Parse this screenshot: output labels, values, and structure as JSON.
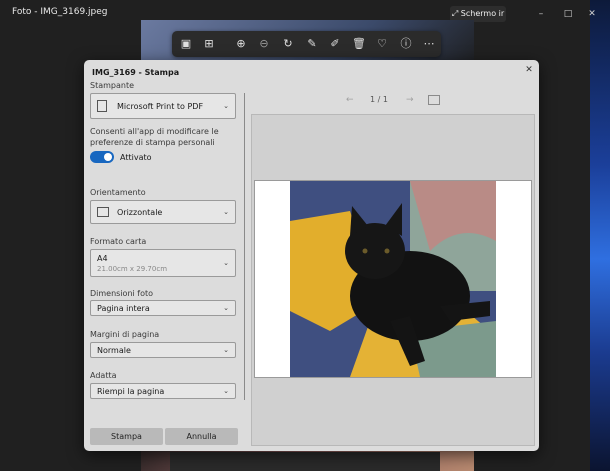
{
  "app": {
    "title": "Foto - IMG_3169.jpeg",
    "screen_button_label": "Schermo ir"
  },
  "window_controls": {
    "minimize": "–",
    "maximize": "□",
    "close": "✕"
  },
  "dialog": {
    "title": "IMG_3169 - Stampa",
    "printer": {
      "label": "Stampante",
      "value": "Microsoft Print to PDF"
    },
    "permission": {
      "text": "Consenti all'app di modificare le preferenze di stampa personali",
      "state": "Attivato"
    },
    "orientation": {
      "label": "Orientamento",
      "value": "Orizzontale"
    },
    "paper": {
      "label": "Formato carta",
      "value": "A4",
      "sub": "21.00cm x 29.70cm"
    },
    "photo_size": {
      "label": "Dimensioni foto",
      "value": "Pagina intera"
    },
    "margins": {
      "label": "Margini di pagina",
      "value": "Normale"
    },
    "fit": {
      "label": "Adatta",
      "value": "Riempi la pagina"
    },
    "print_button": "Stampa",
    "cancel_button": "Annulla",
    "pager": {
      "text": "1 / 1"
    }
  },
  "icons": {
    "toolbar": [
      "image-icon",
      "crop-icon",
      "zoom-in-icon",
      "zoom-out-icon",
      "rotate-icon",
      "edit-icon",
      "draw-icon",
      "delete-icon",
      "favorite-icon",
      "info-icon",
      "more-icon"
    ]
  },
  "colors": {
    "accent": "#1867c0",
    "dialog_bg": "#dcdcdc",
    "window_bg": "#202020"
  }
}
